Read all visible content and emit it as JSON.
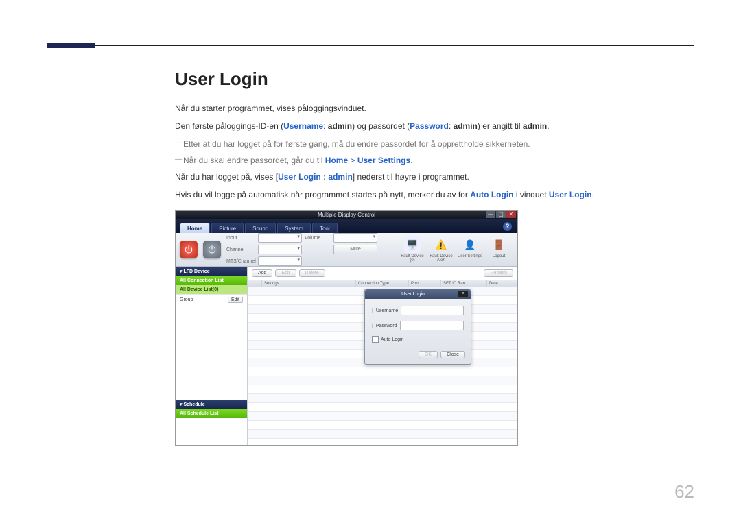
{
  "doc": {
    "heading": "User Login",
    "p1": "Når du starter programmet, vises påloggingsvinduet.",
    "p2a": "Den første påloggings-ID-en (",
    "p2b": "Username",
    "p2c": ": ",
    "p2d": "admin",
    "p2e": ") og passordet (",
    "p2f": "Password",
    "p2g": ": ",
    "p2h": "admin",
    "p2i": ") er angitt til ",
    "p2j": "admin",
    "p2k": ".",
    "note1": "Etter at du har logget på for første gang, må du endre passordet for å opprettholde sikkerheten.",
    "note2a": "Når du skal endre passordet, går du til ",
    "note2b": "Home",
    "note2c": " > ",
    "note2d": "User Settings",
    "note2e": ".",
    "p3a": "Når du har logget på, vises [",
    "p3b": "User Login : admin",
    "p3c": "] nederst til høyre i programmet.",
    "p4a": "Hvis du vil logge på automatisk når programmet startes på nytt, merker du av for ",
    "p4b": "Auto Login",
    "p4c": " i vinduet ",
    "p4d": "User Login",
    "p4e": "."
  },
  "app": {
    "title": "Multiple Display Control",
    "tabs": [
      "Home",
      "Picture",
      "Sound",
      "System",
      "Tool"
    ],
    "help": "?",
    "fields": {
      "input": "Input",
      "channel": "Channel",
      "mtschannel": "MTS/Channel",
      "volume": "Volume",
      "mute": "Mute"
    },
    "toolbar": {
      "fault_device": "Fault Device (0)",
      "fault_alert": "Fault Device Alert",
      "user_settings": "User Settings",
      "logout": "Logout"
    },
    "sidebar": {
      "lfd": "LFD Device",
      "all_conn": "All Connection List",
      "all_dev": "All Device List(0)",
      "group": "Group",
      "edit": "Edit",
      "schedule": "Schedule",
      "all_sched": "All Schedule List"
    },
    "buttons": {
      "add": "Add",
      "edit": "Edit",
      "delete": "Delete",
      "refresh": "Refresh"
    },
    "grid_cols": [
      "",
      "Settings",
      "Connection Type",
      "Port",
      "SET ID Ran...",
      "Dete"
    ],
    "login": {
      "title": "User Login",
      "username": "Username",
      "password": "Password",
      "auto": "Auto Login",
      "ok": "OK",
      "close": "Close"
    }
  },
  "page_number": "62"
}
